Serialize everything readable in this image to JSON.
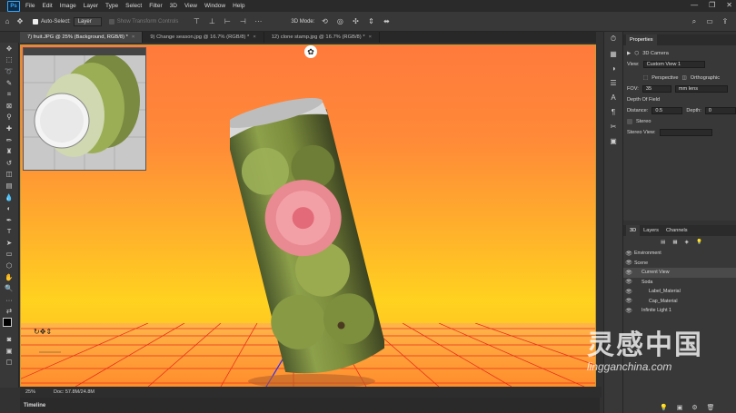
{
  "menu": {
    "logo": "Ps",
    "items": [
      "File",
      "Edit",
      "Image",
      "Layer",
      "Type",
      "Select",
      "Filter",
      "3D",
      "View",
      "Window",
      "Help"
    ]
  },
  "options": {
    "auto_select_label": "Auto-Select:",
    "auto_select_value": "Layer",
    "show_transform_label": "Show Transform Controls",
    "mode_label": "3D Mode:"
  },
  "tabs": [
    {
      "label": "7) fruit.JPG @ 25% (Background, RGB/8) *",
      "active": true
    },
    {
      "label": "9) Change season.jpg @ 16.7% (RGB/8) *",
      "active": false
    },
    {
      "label": "12) clone stamp.jpg @ 16.7% (RGB/8) *",
      "active": false
    }
  ],
  "status": {
    "zoom": "25%",
    "doc": "Doc: 57.8M/24.8M"
  },
  "timeline_label": "Timeline",
  "properties": {
    "title": "Properties",
    "camera_label": "3D Camera",
    "view_label": "View:",
    "view_value": "Custom View 1",
    "perspective_label": "Perspective",
    "orthographic_label": "Orthographic",
    "fov_label": "FOV:",
    "fov_value": "35",
    "lens_value": "mm lens",
    "dof_label": "Depth Of Field",
    "distance_label": "Distance:",
    "distance_value": "0.5",
    "depth_label": "Depth:",
    "depth_value": "0",
    "stereo_label": "Stereo",
    "stereo_view_label": "Stereo View:"
  },
  "layers_panel": {
    "tabs": [
      "3D",
      "Layers",
      "Channels"
    ],
    "rows": [
      {
        "label": "Environment",
        "indent": 0,
        "selected": false
      },
      {
        "label": "Scene",
        "indent": 0,
        "selected": false
      },
      {
        "label": "Current View",
        "indent": 1,
        "selected": true
      },
      {
        "label": "Soda",
        "indent": 1,
        "selected": false
      },
      {
        "label": "Label_Material",
        "indent": 2,
        "selected": false
      },
      {
        "label": "Cap_Material",
        "indent": 2,
        "selected": false
      },
      {
        "label": "Infinite Light 1",
        "indent": 1,
        "selected": false
      }
    ]
  },
  "watermark": {
    "brand": "灵感中国",
    "url": "lingganchina.com"
  },
  "colors": {
    "accent": "#31a8ff",
    "canvas_border": "#c69b32",
    "grid_line": "#e8311a",
    "axis_blue": "#2b2bff"
  }
}
